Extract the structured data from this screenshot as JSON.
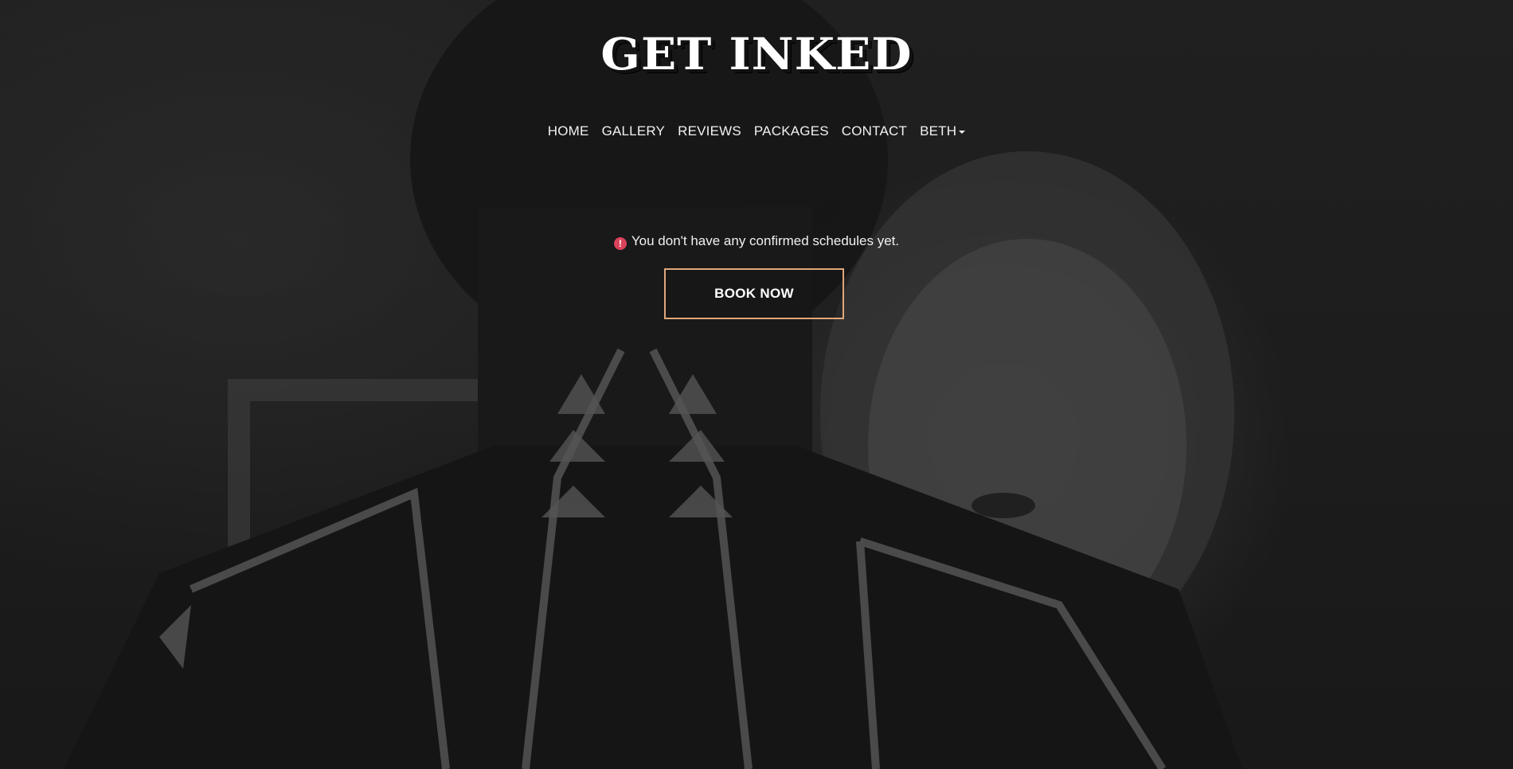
{
  "brand": {
    "logo_text": "GET INKED"
  },
  "nav": {
    "items": [
      {
        "label": "HOME"
      },
      {
        "label": "GALLERY"
      },
      {
        "label": "REVIEWS"
      },
      {
        "label": "PACKAGES"
      },
      {
        "label": "CONTACT"
      },
      {
        "label": "BETH",
        "dropdown": true
      }
    ]
  },
  "notice": {
    "icon": "exclamation-circle-icon",
    "text": "You don't have any confirmed schedules yet."
  },
  "cta": {
    "label": "BOOK NOW"
  },
  "colors": {
    "accent_border": "#e0a77a",
    "alert_icon": "#d9435a",
    "text": "#ffffff"
  }
}
